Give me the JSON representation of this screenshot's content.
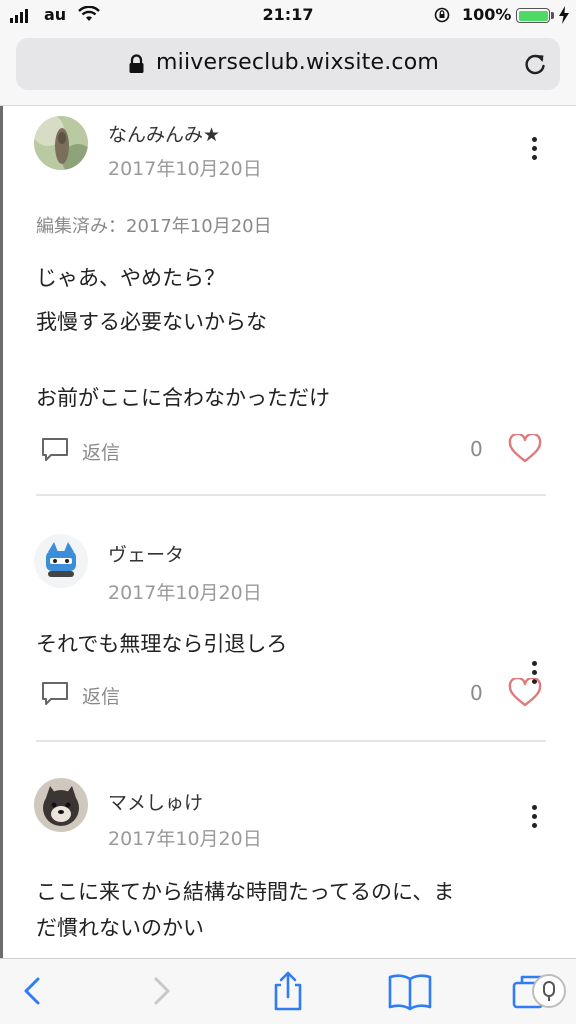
{
  "status_bar": {
    "carrier": "au",
    "time": "21:17",
    "battery_percent": "100%",
    "battery_level": 1.0,
    "battery_color": "#4cd964"
  },
  "browser": {
    "url": "miiverseclub.wixsite.com",
    "icons": [
      "lock-icon",
      "reload-icon"
    ]
  },
  "comments": [
    {
      "author": "なんみんみ★",
      "date": "2017年10月20日",
      "edited": "編集済み：2017年10月20日",
      "body": [
        "じゃあ、やめたら？",
        "我慢する必要ないからな",
        "",
        "お前がここに合わなかっただけ"
      ],
      "reply_label": "返信",
      "likes": "0"
    },
    {
      "author": "ヴェータ",
      "date": "2017年10月20日",
      "body": [
        "それでも無理なら引退しろ"
      ],
      "reply_label": "返信",
      "likes": "0"
    },
    {
      "author": "マメしゅけ",
      "date": "2017年10月20日",
      "body": [
        "ここに来てから結構な時間たってるのに、ま",
        "だ慣れないのかい"
      ]
    }
  ],
  "toolbar": {
    "icons": [
      "back-icon",
      "forward-icon",
      "share-icon",
      "bookmarks-icon",
      "tabs-icon"
    ]
  },
  "colors": {
    "heart": "#e07a7a",
    "divider": "#e6e6e6",
    "ios_blue": "#2f7cf6"
  }
}
